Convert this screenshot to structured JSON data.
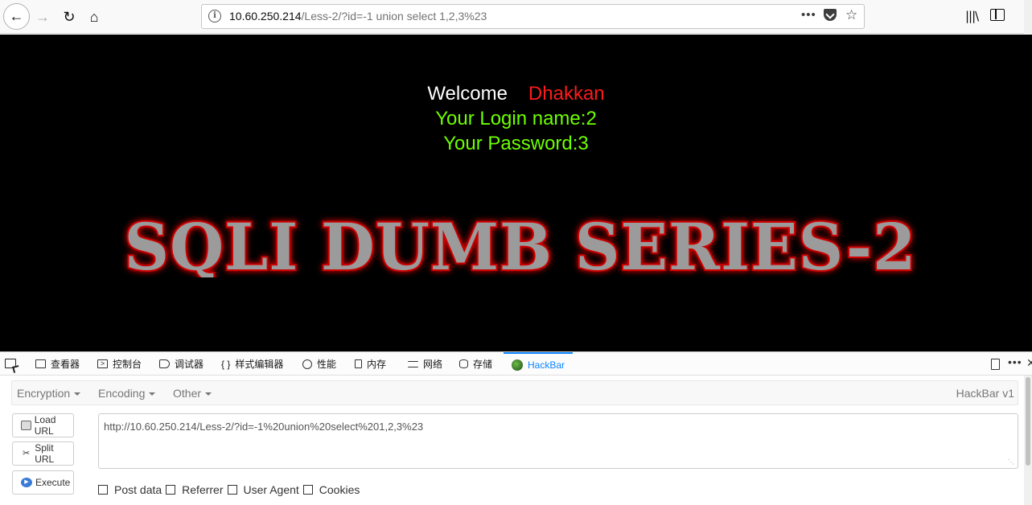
{
  "browser": {
    "url_host": "10.60.250.214",
    "url_path": "/Less-2/?id=-1 union select 1,2,3%23",
    "icons": {
      "back": "back-arrow-icon",
      "forward": "forward-arrow-icon",
      "reload": "reload-icon",
      "home": "home-icon",
      "info": "info-icon",
      "more": "more-dots-icon",
      "pocket": "pocket-icon",
      "bookmark": "star-icon",
      "library": "library-icon",
      "sidebar": "sidebar-icon"
    }
  },
  "page": {
    "welcome_word": "Welcome",
    "welcome_name": "Dhakkan",
    "login_line": "Your Login name:2",
    "password_line": "Your Password:3",
    "banner": "SQLI DUMB SERIES-2",
    "colors": {
      "background": "#000000",
      "welcome": "#ffffff",
      "name": "#ff1a1a",
      "result": "#6dff00"
    }
  },
  "devtools": {
    "tabs": [
      {
        "label": "查看器",
        "icon": "inspector-icon"
      },
      {
        "label": "控制台",
        "icon": "console-icon"
      },
      {
        "label": "调试器",
        "icon": "debugger-icon"
      },
      {
        "label": "样式编辑器",
        "icon": "style-editor-icon"
      },
      {
        "label": "性能",
        "icon": "performance-icon"
      },
      {
        "label": "内存",
        "icon": "memory-icon"
      },
      {
        "label": "网络",
        "icon": "network-icon"
      },
      {
        "label": "存储",
        "icon": "storage-icon"
      },
      {
        "label": "HackBar",
        "icon": "hackbar-icon",
        "active": true
      }
    ],
    "accent": "#0a84ff"
  },
  "hackbar": {
    "menus": [
      "Encryption",
      "Encoding",
      "Other"
    ],
    "version": "HackBar v1",
    "buttons": {
      "load": "Load URL",
      "split": "Split URL",
      "execute": "Execute"
    },
    "url_value": "http://10.60.250.214/Less-2/?id=-1%20union%20select%201,2,3%23",
    "options": [
      "Post data",
      "Referrer",
      "User Agent",
      "Cookies"
    ]
  }
}
